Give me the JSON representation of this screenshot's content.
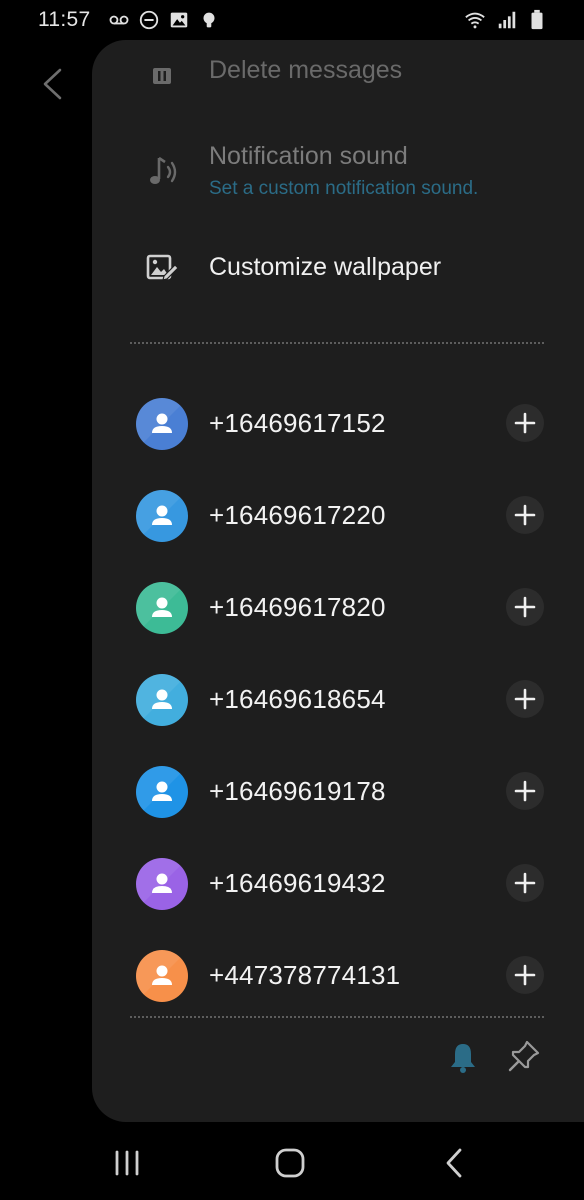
{
  "status_bar": {
    "time": "11:57",
    "left_icons": [
      "voicemail-icon",
      "do-not-disturb-icon",
      "image-icon",
      "bulb-icon"
    ],
    "right_icons": [
      "wifi-icon",
      "signal-icon",
      "battery-icon"
    ]
  },
  "menu": {
    "delete_messages": {
      "label": "Delete messages",
      "icon": "trash-icon"
    },
    "notification_sound": {
      "label": "Notification sound",
      "sub": "Set a custom notification sound.",
      "icon": "music-note-icon"
    },
    "customize_wallpaper": {
      "label": "Customize wallpaper",
      "icon": "wallpaper-icon"
    }
  },
  "contacts": [
    {
      "number": "+16469617152",
      "color": "#4a7fd4"
    },
    {
      "number": "+16469617220",
      "color": "#3798e0"
    },
    {
      "number": "+16469617820",
      "color": "#3dbb96"
    },
    {
      "number": "+16469618654",
      "color": "#42aede"
    },
    {
      "number": "+16469619178",
      "color": "#1f93e6"
    },
    {
      "number": "+16469619432",
      "color": "#9a63e6"
    },
    {
      "number": "+447378774131",
      "color": "#f7904a"
    }
  ],
  "colors": {
    "panel_bg": "#1e1e1e",
    "accent": "#2b6c87"
  },
  "bottom_actions": [
    "bell-icon",
    "pin-icon"
  ],
  "nav": [
    "recent-apps-icon",
    "home-icon",
    "back-icon"
  ]
}
